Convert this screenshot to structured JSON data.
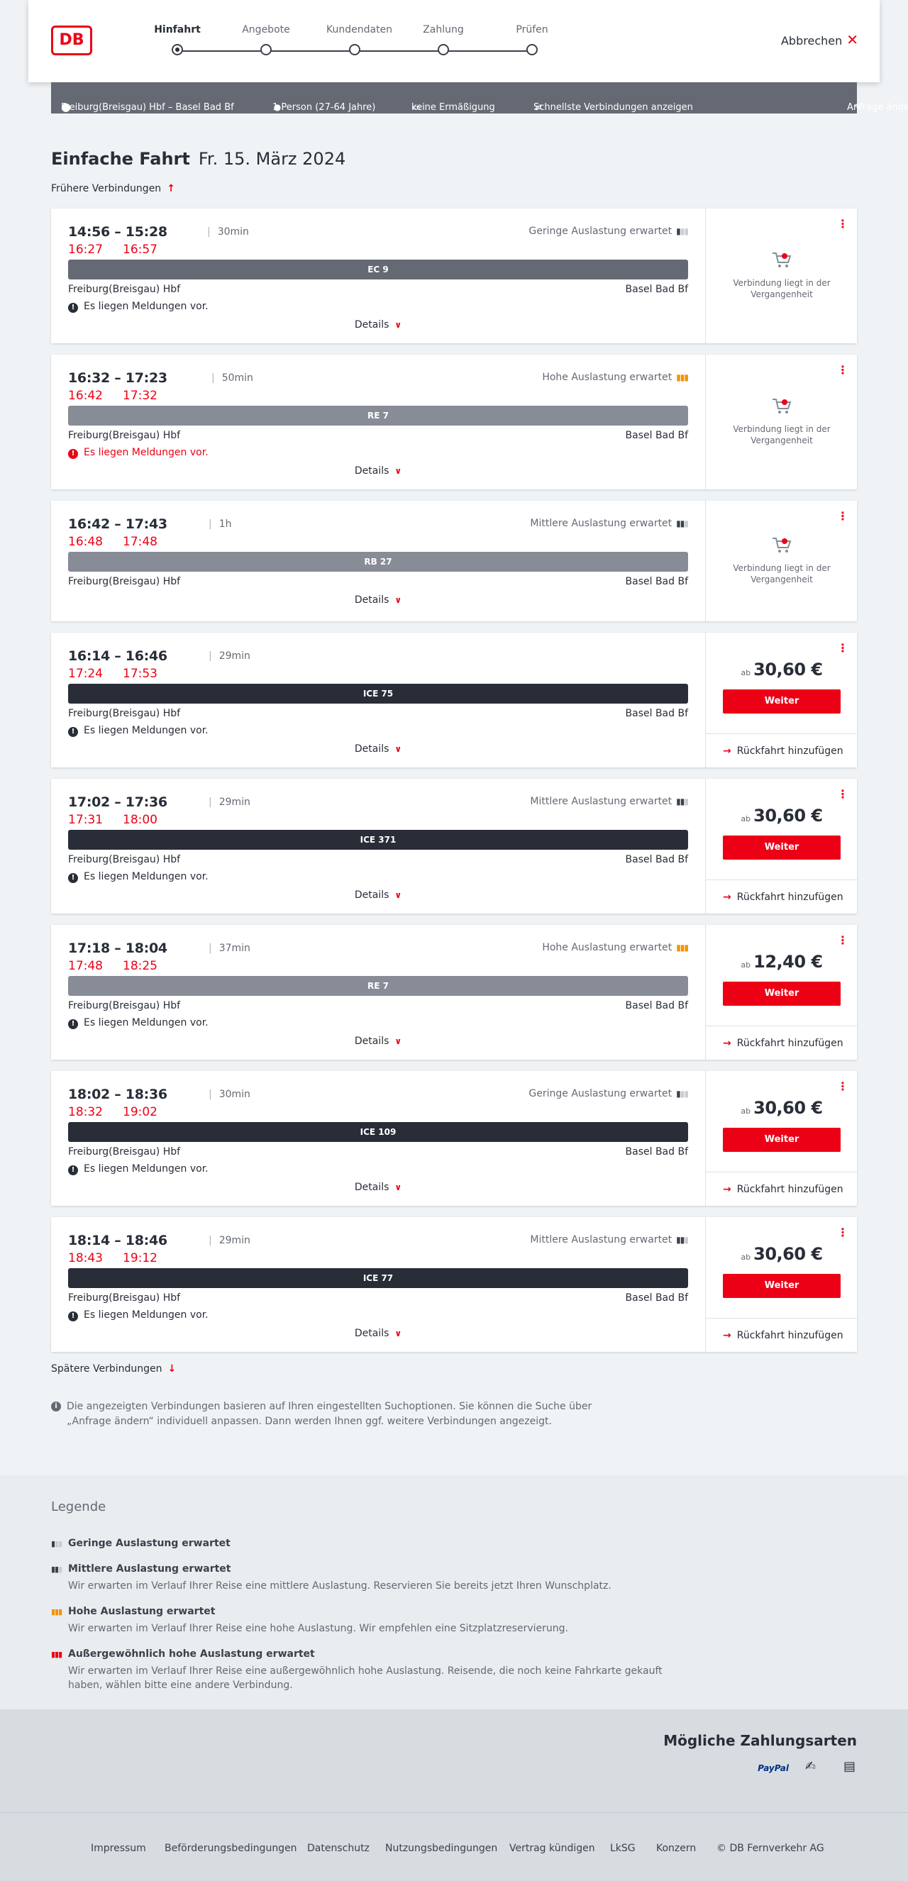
{
  "header": {
    "logo": "DB",
    "steps": [
      "Hinfahrt",
      "Angebote",
      "Kundendaten",
      "Zahlung",
      "Prüfen"
    ],
    "cancel": "Abbrechen"
  },
  "summary": {
    "route": "Freiburg(Breisgau) Hbf – Basel Bad Bf",
    "persons": "1 Person (27-64 Jahre)",
    "discount": "keine Ermäßigung",
    "fastest": "Schnellste Verbindungen anzeigen",
    "change": "Anfrage ändern"
  },
  "title": {
    "trip": "Einfache Fahrt",
    "date": "Fr. 15. März 2024"
  },
  "earlier": "Frühere Verbindungen",
  "later": "Spätere Verbindungen",
  "colors": {
    "red": "#ec0016",
    "dark_train": "#282d37",
    "grey_train": "#878c96",
    "ec_train": "#646973",
    "orange": "#f39200"
  },
  "connections": [
    {
      "time": "14:56 – 15:28",
      "duration": "30min",
      "rt_dep": "16:27",
      "rt_arr": "16:57",
      "load": "Geringe Auslastung erwartet",
      "load_icon": "low",
      "train": "EC 9",
      "from": "Freiburg(Breisgau) Hbf",
      "to": "Basel Bad Bf",
      "notice": "Es liegen Meldungen vor.",
      "notice_red": false,
      "details": "Details",
      "past": "Verbindung liegt in der Vergangenheit"
    },
    {
      "time": "16:32 – 17:23",
      "duration": "50min",
      "rt_dep": "16:42",
      "rt_arr": "17:32",
      "load": "Hohe Auslastung erwartet",
      "load_icon": "high",
      "train": "RE 7",
      "from": "Freiburg(Breisgau) Hbf",
      "to": "Basel Bad Bf",
      "notice": "Es liegen Meldungen vor.",
      "notice_red": true,
      "details": "Details",
      "past": "Verbindung liegt in der Vergangenheit"
    },
    {
      "time": "16:42 – 17:43",
      "duration": "1h",
      "rt_dep": "16:48",
      "rt_arr": "17:48",
      "load": "Mittlere Auslastung erwartet",
      "load_icon": "mid",
      "train": "RB 27",
      "from": "Freiburg(Breisgau) Hbf",
      "to": "Basel Bad Bf",
      "notice": "",
      "details": "Details",
      "past": "Verbindung liegt in der Vergangenheit"
    },
    {
      "time": "16:14 – 16:46",
      "duration": "29min",
      "rt_dep": "17:24",
      "rt_arr": "17:53",
      "load": "",
      "train": "ICE 75",
      "from": "Freiburg(Breisgau) Hbf",
      "to": "Basel Bad Bf",
      "notice": "Es liegen Meldungen vor.",
      "notice_red": false,
      "details": "Details",
      "price_prefix": "ab",
      "price": "30,60 €",
      "button": "Weiter",
      "return": "Rückfahrt hinzufügen"
    },
    {
      "time": "17:02 – 17:36",
      "duration": "29min",
      "rt_dep": "17:31",
      "rt_arr": "18:00",
      "load": "Mittlere Auslastung erwartet",
      "load_icon": "mid",
      "train": "ICE 371",
      "from": "Freiburg(Breisgau) Hbf",
      "to": "Basel Bad Bf",
      "notice": "Es liegen Meldungen vor.",
      "notice_red": false,
      "details": "Details",
      "price_prefix": "ab",
      "price": "30,60 €",
      "button": "Weiter",
      "return": "Rückfahrt hinzufügen"
    },
    {
      "time": "17:18 – 18:04",
      "duration": "37min",
      "rt_dep": "17:48",
      "rt_arr": "18:25",
      "load": "Hohe Auslastung erwartet",
      "load_icon": "high",
      "train": "RE 7",
      "from": "Freiburg(Breisgau) Hbf",
      "to": "Basel Bad Bf",
      "notice": "Es liegen Meldungen vor.",
      "notice_red": false,
      "details": "Details",
      "price_prefix": "ab",
      "price": "12,40 €",
      "button": "Weiter",
      "return": "Rückfahrt hinzufügen"
    },
    {
      "time": "18:02 – 18:36",
      "duration": "30min",
      "rt_dep": "18:32",
      "rt_arr": "19:02",
      "load": "Geringe Auslastung erwartet",
      "load_icon": "low",
      "train": "ICE 109",
      "from": "Freiburg(Breisgau) Hbf",
      "to": "Basel Bad Bf",
      "notice": "Es liegen Meldungen vor.",
      "notice_red": false,
      "details": "Details",
      "price_prefix": "ab",
      "price": "30,60 €",
      "button": "Weiter",
      "return": "Rückfahrt hinzufügen"
    },
    {
      "time": "18:14 – 18:46",
      "duration": "29min",
      "rt_dep": "18:43",
      "rt_arr": "19:12",
      "load": "Mittlere Auslastung erwartet",
      "load_icon": "mid",
      "train": "ICE 77",
      "from": "Freiburg(Breisgau) Hbf",
      "to": "Basel Bad Bf",
      "notice": "Es liegen Meldungen vor.",
      "notice_red": false,
      "details": "Details",
      "price_prefix": "ab",
      "price": "30,60 €",
      "button": "Weiter",
      "return": "Rückfahrt hinzufügen"
    }
  ],
  "info_note": "Die angezeigten Verbindungen basieren auf Ihren eingestellten Suchoptionen. Sie können die Suche über „Anfrage ändern“ individuell anpassen. Dann werden Ihnen ggf. weitere Verbindungen angezeigt.",
  "legend": {
    "title": "Legende",
    "items": [
      {
        "label": "Geringe Auslastung erwartet",
        "text": ""
      },
      {
        "label": "Mittlere Auslastung erwartet",
        "text": "Wir erwarten im Verlauf Ihrer Reise eine mittlere Auslastung. Reservieren Sie bereits jetzt Ihren Wunschplatz."
      },
      {
        "label": "Hohe Auslastung erwartet",
        "text": "Wir erwarten im Verlauf Ihrer Reise eine hohe Auslastung. Wir empfehlen eine Sitzplatzreservierung."
      },
      {
        "label": "Außergewöhnlich hohe Auslastung erwartet",
        "text": "Wir erwarten im Verlauf Ihrer Reise eine außergewöhnlich hohe Auslastung. Reisende, die noch keine Fahrkarte gekauft haben, wählen bitte eine andere Verbindung."
      }
    ]
  },
  "payment": {
    "title": "Mögliche Zahlungsarten",
    "methods": [
      "PayPal",
      "credit-card-icon",
      "invoice-icon"
    ]
  },
  "footer": [
    "Impressum",
    "Beförderungsbedingungen",
    "Datenschutz",
    "Nutzungsbedingungen",
    "Vertrag kündigen",
    "LkSG",
    "Konzern",
    "© DB Fernverkehr AG"
  ]
}
